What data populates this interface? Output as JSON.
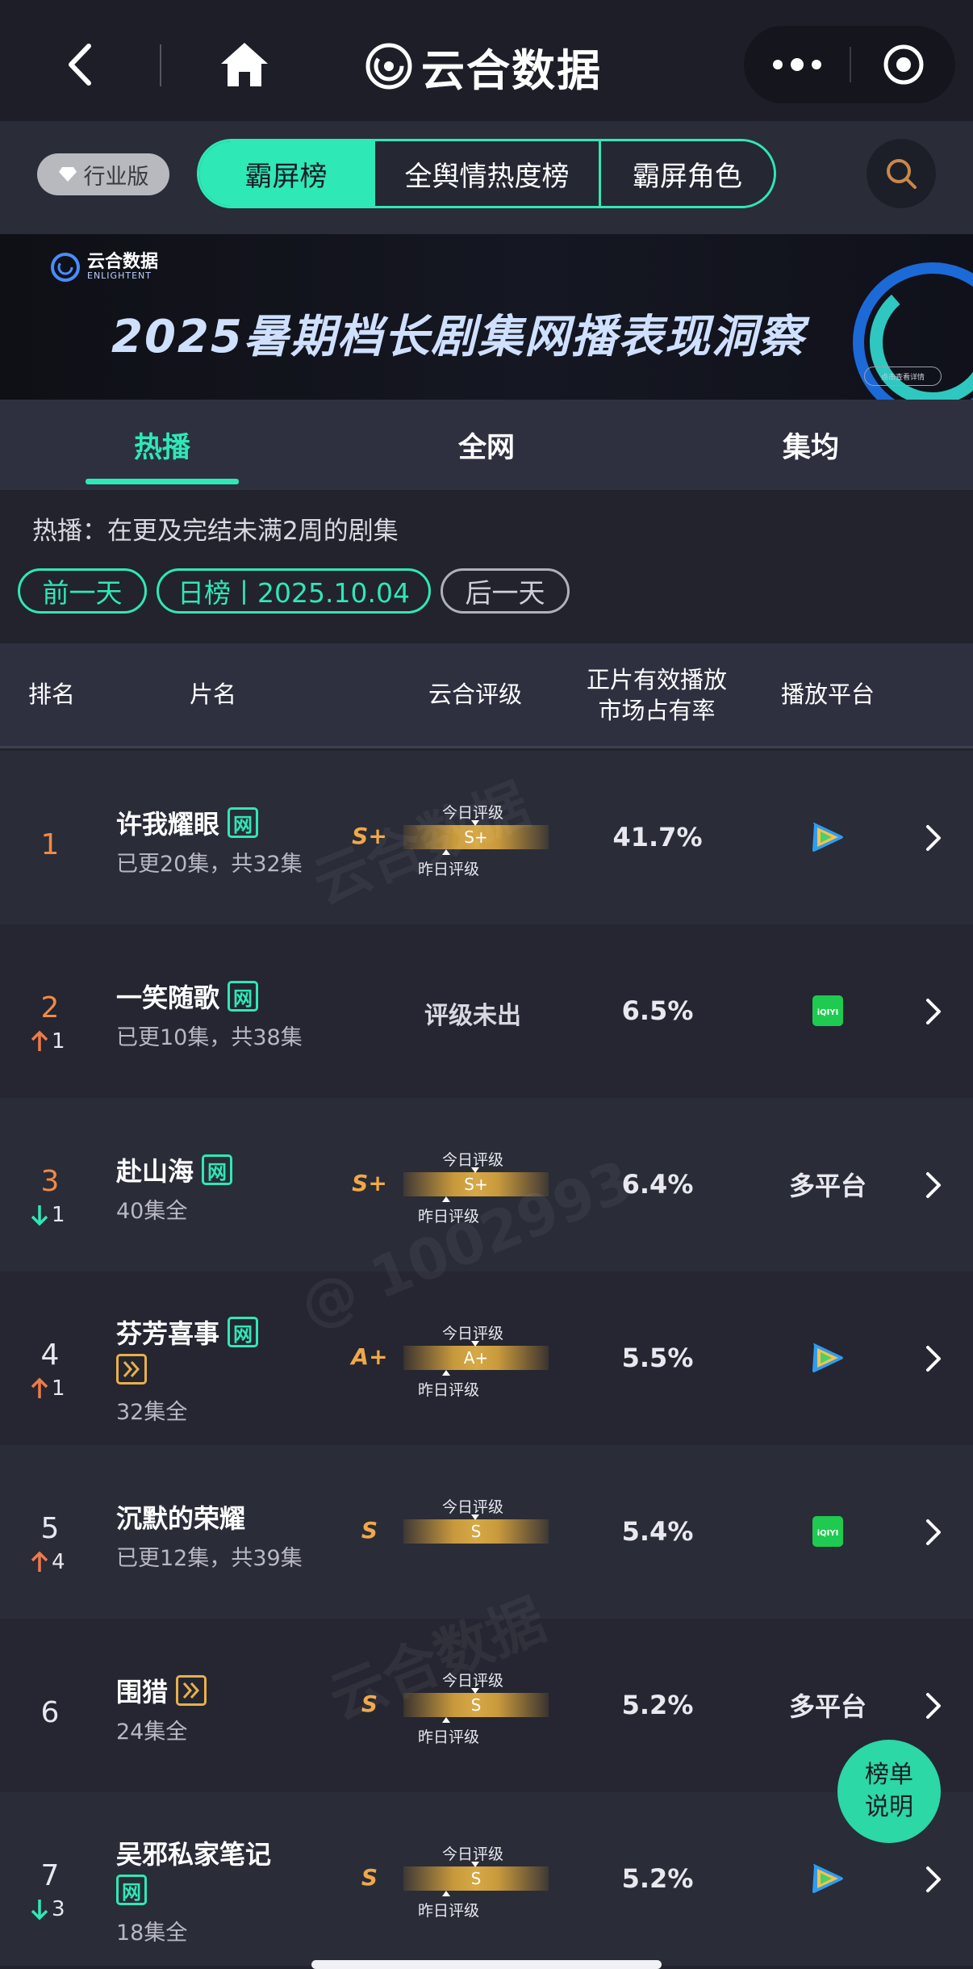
{
  "nav": {
    "app_title": "云合数据"
  },
  "filters": {
    "edition_label": "行业版",
    "segments": [
      "霸屏榜",
      "全舆情热度榜",
      "霸屏角色"
    ],
    "active_segment": "霸屏榜"
  },
  "banner": {
    "logo_text": "云合数据",
    "logo_sub": "ENLIGHTENT",
    "title": "2025暑期档长剧集网播表现洞察",
    "cta": "点击查看详情"
  },
  "tabs": {
    "items": [
      "热播",
      "全网",
      "集均"
    ],
    "active": "热播"
  },
  "info": {
    "description": "热播：在更及完结未满2周的剧集",
    "prev_label": "前一天",
    "date_label": "日榜丨2025.10.04",
    "next_label": "后一天"
  },
  "table": {
    "headers": {
      "rank": "排名",
      "title": "片名",
      "grade": "云合评级",
      "share_line1": "正片有效播放",
      "share_line2": "市场占有率",
      "platform": "播放平台"
    },
    "today_label": "今日评级",
    "yesterday_label": "昨日评级",
    "rows": [
      {
        "rank": "1",
        "change": "",
        "dir": "",
        "title": "许我耀眼",
        "net": "网",
        "exclusive": false,
        "sub": "已更20集，共32集",
        "grade": "S+",
        "today": "S+",
        "show_today": true,
        "show_yesterday": true,
        "share": "41.7%",
        "platform": "tencent-video-icon",
        "platform_text": ""
      },
      {
        "rank": "2",
        "change": "1",
        "dir": "up",
        "title": "一笑随歌",
        "net": "网",
        "exclusive": false,
        "sub": "已更10集，共38集",
        "grade": "",
        "grade_none": "评级未出",
        "share": "6.5%",
        "platform": "iqiyi-icon",
        "platform_text": ""
      },
      {
        "rank": "3",
        "change": "1",
        "dir": "down",
        "title": "赴山海",
        "net": "网",
        "exclusive": false,
        "sub": "40集全",
        "grade": "S+",
        "today": "S+",
        "show_today": true,
        "show_yesterday": true,
        "share": "6.4%",
        "platform": "",
        "platform_text": "多平台"
      },
      {
        "rank": "4",
        "change": "1",
        "dir": "up",
        "title": "芬芳喜事",
        "net": "网",
        "exclusive": true,
        "sub": "32集全",
        "grade": "A+",
        "today": "A+",
        "show_today": true,
        "show_yesterday": true,
        "share": "5.5%",
        "platform": "tencent-video-icon",
        "platform_text": ""
      },
      {
        "rank": "5",
        "change": "4",
        "dir": "up",
        "title": "沉默的荣耀",
        "net": "",
        "exclusive": false,
        "sub": "已更12集，共39集",
        "grade": "S",
        "today": "S",
        "show_today": true,
        "show_yesterday": false,
        "share": "5.4%",
        "platform": "iqiyi-icon",
        "platform_text": ""
      },
      {
        "rank": "6",
        "change": "",
        "dir": "",
        "title": "围猎",
        "net": "",
        "exclusive": true,
        "sub": "24集全",
        "grade": "S",
        "today": "S",
        "show_today": true,
        "show_yesterday": true,
        "share": "5.2%",
        "platform": "",
        "platform_text": "多平台"
      },
      {
        "rank": "7",
        "change": "3",
        "dir": "down",
        "title": "吴邪私家笔记",
        "net": "网",
        "exclusive": false,
        "sub": "18集全",
        "grade": "S",
        "today": "S",
        "show_today": true,
        "show_yesterday": true,
        "share": "5.2%",
        "platform": "tencent-video-icon",
        "platform_text": ""
      }
    ]
  },
  "fab": {
    "line1": "榜单",
    "line2": "说明"
  },
  "watermarks": [
    "云合数据",
    "@ 1002993"
  ],
  "colors": {
    "accent": "#2ee8b6",
    "rank_top": "#f08a48",
    "grade": "#f0a848",
    "up": "#f07a48",
    "down": "#2ee8b6"
  }
}
